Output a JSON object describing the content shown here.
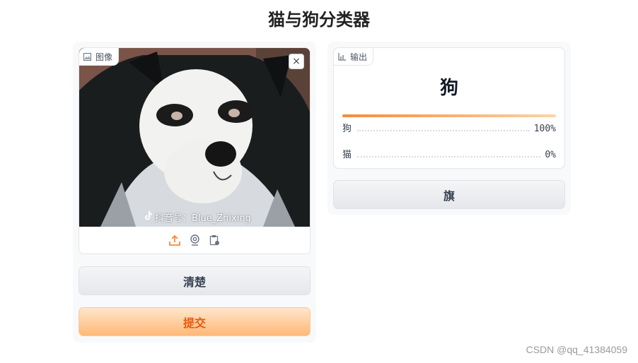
{
  "app": {
    "title": "猫与狗分类器"
  },
  "input": {
    "tag_label": "图像",
    "close_symbol": "×",
    "watermark": "抖音号：Blue_Zhixing",
    "sources": [
      "upload-icon",
      "webcam-icon",
      "clipboard-icon"
    ]
  },
  "buttons": {
    "clear": "清楚",
    "submit": "提交",
    "flag": "旗"
  },
  "output": {
    "tag_label": "输出",
    "label": "狗",
    "confidences": [
      {
        "label": "狗",
        "value": "100%"
      },
      {
        "label": "猫",
        "value": "0%"
      }
    ]
  },
  "footer": {
    "credit": "CSDN @qq_41384059"
  },
  "colors": {
    "accent": "#f58a3a",
    "primary_text": "#ea580c"
  }
}
